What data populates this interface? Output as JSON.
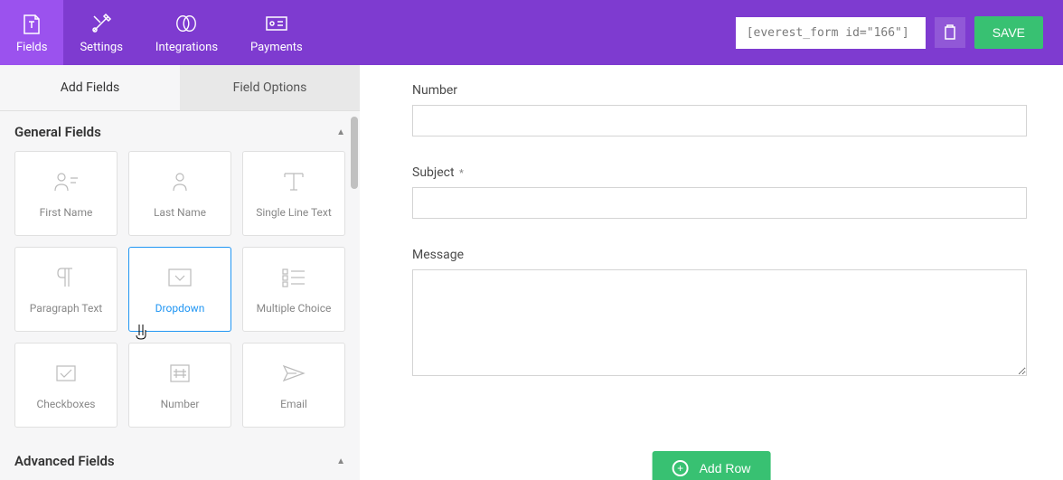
{
  "topbar": {
    "items": [
      {
        "label": "Fields"
      },
      {
        "label": "Settings"
      },
      {
        "label": "Integrations"
      },
      {
        "label": "Payments"
      }
    ],
    "shortcode": "[everest_form id=\"166\"]",
    "save_label": "SAVE"
  },
  "sidebar": {
    "tabs": {
      "add_fields": "Add Fields",
      "field_options": "Field Options"
    },
    "sections": {
      "general": "General Fields",
      "advanced": "Advanced Fields"
    },
    "general_fields": [
      {
        "name": "first-name",
        "label": "First Name"
      },
      {
        "name": "last-name",
        "label": "Last Name"
      },
      {
        "name": "single-line-text",
        "label": "Single Line Text"
      },
      {
        "name": "paragraph-text",
        "label": "Paragraph Text"
      },
      {
        "name": "dropdown",
        "label": "Dropdown"
      },
      {
        "name": "multiple-choice",
        "label": "Multiple Choice"
      },
      {
        "name": "checkboxes",
        "label": "Checkboxes"
      },
      {
        "name": "number",
        "label": "Number"
      },
      {
        "name": "email",
        "label": "Email"
      }
    ]
  },
  "preview": {
    "fields": {
      "number_label": "Number",
      "subject_label": "Subject",
      "message_label": "Message"
    },
    "add_row_label": "Add Row"
  }
}
